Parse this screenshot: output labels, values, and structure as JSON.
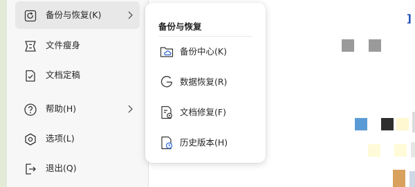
{
  "menu": {
    "items": [
      {
        "label": "备份与恢复(K)",
        "icon": "backup-restore-icon"
      },
      {
        "label": "文件瘦身",
        "icon": "file-slim-icon"
      },
      {
        "label": "文档定稿",
        "icon": "document-finalize-icon"
      },
      {
        "label": "帮助(H)",
        "icon": "help-icon"
      },
      {
        "label": "选项(L)",
        "icon": "options-icon"
      },
      {
        "label": "退出(Q)",
        "icon": "exit-icon"
      }
    ]
  },
  "submenu": {
    "title": "备份与恢复",
    "items": [
      {
        "label": "备份中心(K)",
        "icon": "backup-center-icon"
      },
      {
        "label": "数据恢复(R)",
        "icon": "data-recovery-icon"
      },
      {
        "label": "文档修复(F)",
        "icon": "document-repair-icon"
      },
      {
        "label": "历史版本(H)",
        "icon": "history-version-icon"
      }
    ]
  },
  "document": {
    "edge_text": "]"
  },
  "colors": {
    "accent": "#2b65d9",
    "menu_bg": "#f7f7f7",
    "hover_bg": "#e8e8e8"
  }
}
